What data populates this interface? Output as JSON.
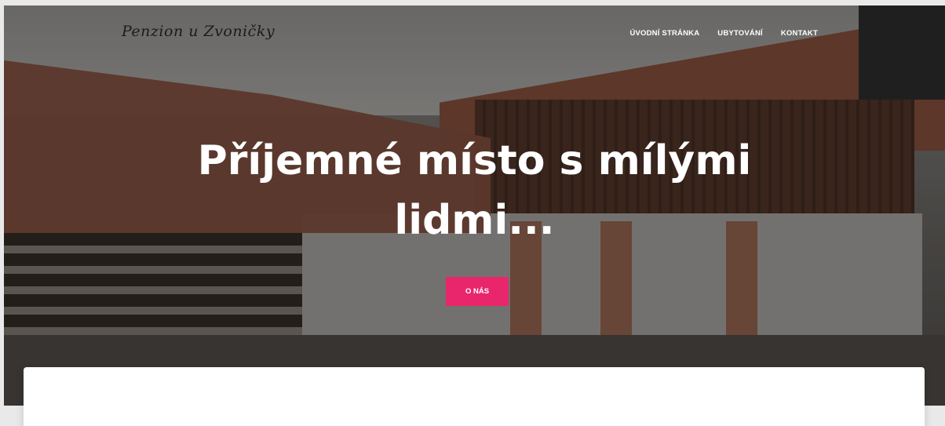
{
  "brand": {
    "logo_text": "Penzion u Zvoničky"
  },
  "nav": {
    "items": [
      {
        "label": "ÚVODNÍ STRÁNKA"
      },
      {
        "label": "UBYTOVÁNÍ"
      },
      {
        "label": "KONTAKT"
      }
    ]
  },
  "hero": {
    "headline_line1": "Příjemné místo s mílými",
    "headline_line2": "lidmi...",
    "cta_label": "O NÁS",
    "cta_color": "#e9266b"
  }
}
